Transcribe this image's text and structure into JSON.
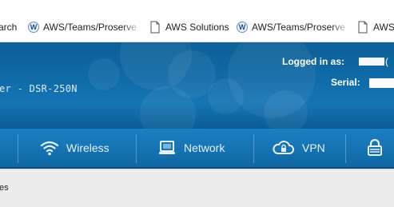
{
  "bookmarks": [
    {
      "label": "arch",
      "icon": "none"
    },
    {
      "label": "AWS/Teams/Proserve",
      "icon": "wiki-icon"
    },
    {
      "label": "AWS Solutions",
      "icon": "page-icon"
    },
    {
      "label": "AWS/Teams/Proserve",
      "icon": "wiki-icon"
    },
    {
      "label": "AWS",
      "icon": "page-icon"
    }
  ],
  "banner": {
    "model": "er - DSR-250N",
    "logged_in_label": "Logged in as:",
    "logged_in_tail": "(",
    "serial_label": "Serial:"
  },
  "nav": {
    "items": [
      {
        "label": "Wireless",
        "icon": "wifi-icon"
      },
      {
        "label": "Network",
        "icon": "monitor-icon"
      },
      {
        "label": "VPN",
        "icon": "cloud-lock-icon"
      },
      {
        "label": "",
        "icon": "lock-icon"
      }
    ]
  },
  "subbar": {
    "text": "es"
  },
  "colors": {
    "banner": "#0f6aa6",
    "nav": "#1573b3",
    "subbar": "#ececec"
  }
}
